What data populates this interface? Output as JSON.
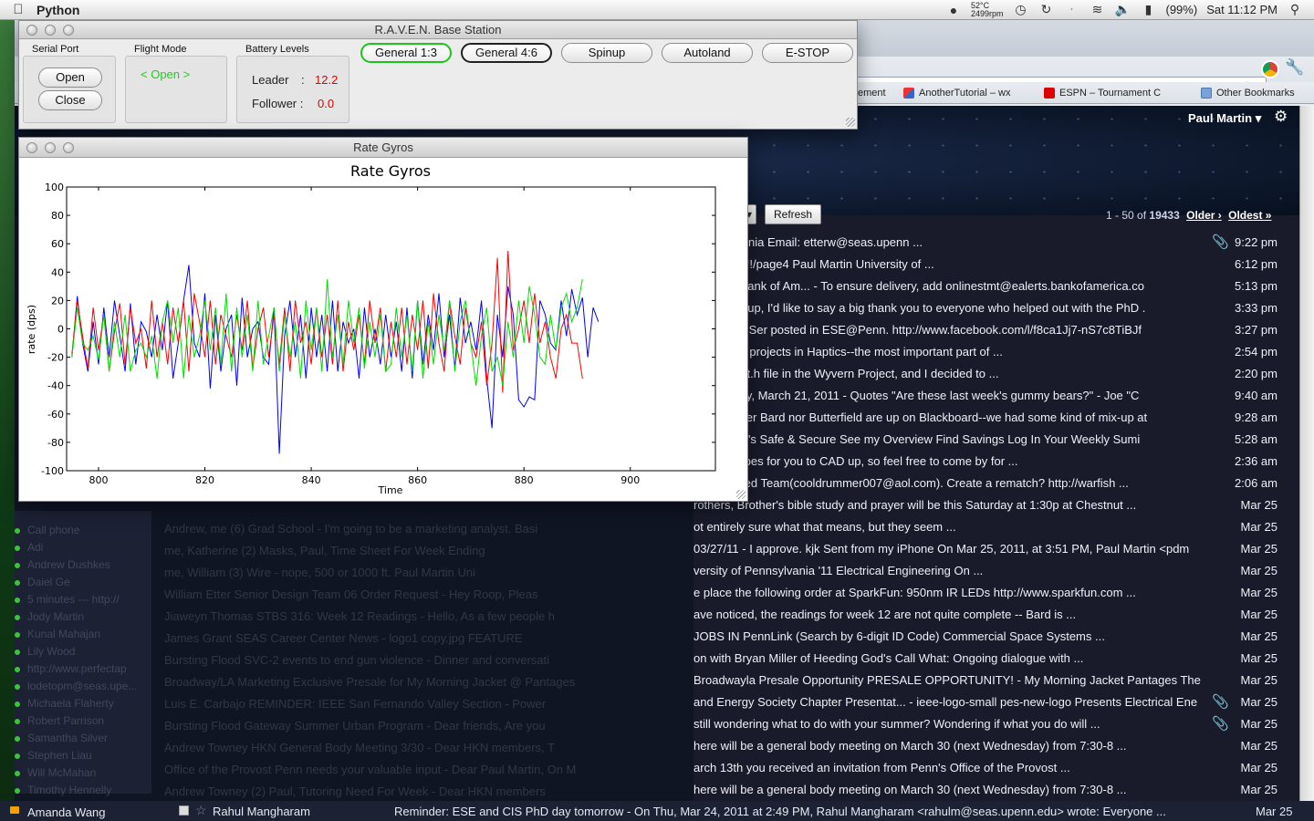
{
  "menubar": {
    "app_name": "Python",
    "temp": "52°C",
    "rpm": "2499rpm",
    "battery": "(99%)",
    "clock": "Sat 11:12 PM"
  },
  "browser": {
    "bookmarks": [
      "ement",
      "AnotherTutorial – wx",
      "ESPN – Tournament C",
      "Other Bookmarks"
    ],
    "user": "Paul Martin",
    "more_label": "s",
    "refresh_label": "Refresh",
    "pager": {
      "range": "1 - 50",
      "of": "of",
      "total": "19433",
      "older": "Older ›",
      "oldest": "Oldest »"
    }
  },
  "emails": [
    {
      "snippet": "Pennsylvania Email: etterw@seas.upenn ...",
      "time": "9:22 pm",
      "attach": true
    },
    {
      "snippet": "New-IMU!!!/page4 Paul Martin University of ...",
      "time": "6:12 pm",
      "attach": false
    },
    {
      "snippet": "ble from Bank of Am... - To ensure delivery, add onlinestmt@ealerts.bankofamerica.co",
      "time": "5:13 pm",
      "attach": false
    },
    {
      "snippet": "aptics Group, I'd like to say a big thank you to everyone who helped out with the PhD .",
      "time": "3:33 pm",
      "attach": false
    },
    {
      "snippet": "Pls... - Jin Ser posted in ESE@Penn. http://www.facebook.com/l/f8ca1Jj7-nS7c8TiBJf",
      "time": "3:27 pm",
      "attach": false
    },
    {
      "snippet": "e for most projects in Haptics--the most important part of ...",
      "time": "2:54 pm",
      "attach": false
    },
    {
      "snippet": "up the uart.h file in the Wyvern Project, and I decided to ...",
      "time": "2:20 pm",
      "attach": false
    },
    {
      "snippet": "on Monday, March 21, 2011 - Quotes \"Are these last week's gummy bears?\" - Joe \"C",
      "time": "9:40 am",
      "attach": false
    },
    {
      "snippet": "ass: Neither Bard nor Butterfield are up on Blackboard--we had some kind of mix-up at",
      "time": "9:28 am",
      "attach": false
    },
    {
      "snippet": "t.com Mint's Safe & Secure See my Overview Find Savings Log In Your Weekly Sumi",
      "time": "5:28 am",
      "attach": false
    },
    {
      "snippet": "crazy shapes for you to CAD up, so feel free to come by for ...",
      "time": "2:36 am",
      "attach": false
    },
    {
      "snippet": "ated by Red Team(cooldrummer007@aol.com). Create a rematch? http://warfish ...",
      "time": "2:06 am",
      "attach": false
    },
    {
      "snippet": "rothers, Brother's bible study and prayer will be this Saturday at 1:30p at Chestnut ...",
      "time": "Mar 25",
      "attach": false
    },
    {
      "snippet": "ot entirely sure what that means, but they seem ...",
      "time": "Mar 25",
      "attach": false
    },
    {
      "snippet": "03/27/11 - I approve. kjk Sent from my iPhone On Mar 25, 2011, at 3:51 PM, Paul Martin <pdm",
      "time": "Mar 25",
      "attach": false
    },
    {
      "snippet": "versity of Pennsylvania '11 Electrical Engineering On ...",
      "time": "Mar 25",
      "attach": false
    },
    {
      "snippet": "e place the following order at SparkFun: 950nm IR LEDs http://www.sparkfun.com ...",
      "time": "Mar 25",
      "attach": false
    },
    {
      "snippet": "ave noticed, the readings for week 12 are not quite complete -- Bard is ...",
      "time": "Mar 25",
      "attach": false
    },
    {
      "snippet": "JOBS IN PennLink (Search by 6-digit ID Code) Commercial Space Systems ...",
      "time": "Mar 25",
      "attach": false
    },
    {
      "snippet": "on with Bryan Miller of Heeding God's Call What: Ongoing dialogue with ...",
      "time": "Mar 25",
      "attach": false
    },
    {
      "snippet": "Broadwayla Presale Opportunity PRESALE OPPORTUNITY! - My Morning Jacket Pantages The",
      "time": "Mar 25",
      "attach": false
    },
    {
      "snippet": "and Energy Society Chapter Presentat... - ieee-logo-small pes-new-logo Presents Electrical Ene",
      "time": "Mar 25",
      "attach": true
    },
    {
      "snippet": "still wondering what to do with your summer? Wondering if what you do will ...",
      "time": "Mar 25",
      "attach": true
    },
    {
      "snippet": "here will be a general body meeting on March 30 (next Wednesday) from 7:30-8 ...",
      "time": "Mar 25",
      "attach": false
    },
    {
      "snippet": "arch 13th you received an invitation from Penn's Office of the Provost ...",
      "time": "Mar 25",
      "attach": false
    },
    {
      "snippet": "here will be a general body meeting on March 30 (next Wednesday) from 7:30-8 ...",
      "time": "Mar 25",
      "attach": false
    }
  ],
  "faded_rows": [
    "Andrew, me (6)   Grad School - I'm going to be a marketing analyst. Basi",
    "me, Katherine (2)   Masks, Paul, Time Sheet For Week Ending",
    "me, William (3)   Wire - nope, 500 or 1000 ft. Paul Martin Uni",
    "William Etter   Senior Design Team 06 Order Request - Hey Roop, Pleas",
    "Jiaweyn Thomas   STBS 316: Week 12 Readings - Hello, As a few people h",
    "James Grant   SEAS Career Center News - logo1 copy.jpg FEATURE",
    "Bursting Flood   SVC-2 events to end gun violence - Dinner and conversati",
    "Broadway/LA Marketing   Exclusive Presale for My Morning Jacket @ Pantages",
    "Luis E. Carbajo   REMINDER: IEEE San Fernando Valley Section - Power",
    "Bursting Flood   Gateway Summer Urban Program - Dear friends, Are you",
    "Andrew Towney   HKN General Body Meeting 3/30 - Dear HKN members, T",
    "Office of the Provost   Penn needs your valuable input - Dear Paul Martin, On M",
    "Andrew Towney (2)   Paul, Tutoring Need For Week - Dear HKN members"
  ],
  "contacts": [
    "Call phone",
    "Adi",
    "Andrew Dushkes",
    "Daiel Ge",
    "5 minutes --- http://",
    "Jody Martin",
    "Kunal Mahajan",
    "Lily Wood",
    "http://www.perfectap",
    "lodetopm@seas.upe...",
    "Michaela Flaherty",
    "Robert Parrison",
    "Samantha Silver",
    "Stephen Liau",
    "Will McMahan",
    "Timothy Hennelly"
  ],
  "bottom_row": {
    "contact": "Amanda Wang",
    "sender": "Rahul Mangharam",
    "snippet": "Reminder: ESE and CIS PhD day tomorrow - On Thu, Mar 24, 2011 at 2:49 PM, Rahul Mangharam <rahulm@seas.upenn.edu> wrote: Everyone ...",
    "time": "Mar 25"
  },
  "raven": {
    "title": "R.A.V.E.N. Base Station",
    "serial_port_label": "Serial Port",
    "open_btn": "Open",
    "close_btn": "Close",
    "flight_mode_label": "Flight Mode",
    "flight_mode_value": "< Open >",
    "battery_label": "Battery Levels",
    "leader_label": "Leader",
    "leader_value": "12.2",
    "follower_label": "Follower :",
    "follower_value": "0.0",
    "colon": ":",
    "buttons": [
      "General 1:3",
      "General 4:6",
      "Spinup",
      "Autoland",
      "E-STOP"
    ],
    "colors": {
      "flight_mode": "#22cc22",
      "battery_value": "#e00000",
      "selected_green": "#1cc41c"
    }
  },
  "gyros_window": {
    "title": "Rate Gyros"
  },
  "chart_data": {
    "type": "line",
    "title": "Rate Gyros",
    "xlabel": "Time",
    "ylabel": "rate (dps)",
    "xlim": [
      794,
      916
    ],
    "ylim": [
      -100,
      100
    ],
    "xticks": [
      800,
      820,
      840,
      860,
      880,
      900
    ],
    "yticks": [
      100,
      80,
      60,
      40,
      20,
      0,
      -20,
      -40,
      -60,
      -80,
      -100
    ],
    "grid": false,
    "x_start": 795,
    "x_step": 1,
    "series": [
      {
        "color": "#0000ff",
        "values": [
          -20,
          23,
          -10,
          -30,
          5,
          -25,
          15,
          -20,
          20,
          -5,
          -30,
          18,
          -25,
          5,
          -2,
          -20,
          10,
          -15,
          20,
          -35,
          -10,
          20,
          45,
          -10,
          -20,
          25,
          -42,
          10,
          -30,
          0,
          10,
          -40,
          22,
          -20,
          0,
          5,
          -20,
          -25,
          15,
          -88,
          -5,
          20,
          -20,
          10,
          -35,
          15,
          -20,
          10,
          -30,
          20,
          -30,
          5,
          -10,
          0,
          -35,
          15,
          -20,
          0,
          -25,
          10,
          -20,
          5,
          -30,
          15,
          -35,
          20,
          -25,
          10,
          -15,
          25,
          -20,
          10,
          -28,
          22,
          -10,
          5,
          -15,
          20,
          -35,
          -70,
          10,
          -20,
          30,
          10,
          -50,
          -55,
          -48,
          -50,
          20,
          10,
          -10,
          -15,
          20,
          -5,
          28,
          10,
          22,
          -20,
          15,
          5
        ]
      },
      {
        "color": "#ff0000",
        "values": [
          -18,
          20,
          -5,
          -28,
          15,
          -15,
          10,
          -30,
          -2,
          18,
          -25,
          15,
          -10,
          0,
          -28,
          20,
          -20,
          5,
          -25,
          15,
          -10,
          20,
          -30,
          25,
          5,
          -20,
          20,
          -25,
          10,
          -5,
          -20,
          10,
          -15,
          20,
          -28,
          0,
          15,
          -20,
          10,
          -25,
          15,
          -30,
          20,
          -10,
          5,
          -25,
          15,
          -20,
          10,
          -25,
          20,
          -30,
          5,
          -15,
          10,
          -25,
          20,
          -10,
          15,
          -30,
          5,
          -20,
          15,
          -25,
          10,
          -15,
          20,
          -28,
          25,
          -10,
          -30,
          20,
          -5,
          -25,
          15,
          -10,
          -20,
          5,
          -40,
          -10,
          50,
          -45,
          55,
          -15,
          0,
          20,
          -10,
          25,
          -10,
          5,
          -20,
          -35,
          0,
          10,
          -10,
          -10,
          -35
        ]
      },
      {
        "color": "#00dd00",
        "values": [
          -20,
          15,
          -10,
          -15,
          -5,
          -22,
          10,
          -30,
          5,
          -20,
          10,
          -30,
          -15,
          -10,
          -20,
          -5,
          -35,
          5,
          20,
          -10,
          15,
          -35,
          10,
          -20,
          -5,
          20,
          -15,
          15,
          -25,
          25,
          -30,
          15,
          -20,
          10,
          -30,
          20,
          -25,
          -5,
          15,
          -30,
          10,
          -20,
          5,
          -35,
          20,
          -15,
          15,
          -30,
          35,
          -20,
          10,
          -25,
          20,
          -10,
          15,
          -28,
          5,
          -20,
          10,
          -30,
          -25,
          15,
          -20,
          10,
          -30,
          20,
          -35,
          5,
          -25,
          10,
          -15,
          20,
          -30,
          5,
          20,
          -10,
          -40,
          -5,
          15,
          -30,
          -20,
          -40,
          5,
          -20,
          20,
          -10,
          30,
          10,
          -20,
          -25,
          10,
          -15,
          15,
          25,
          5,
          15,
          35
        ]
      }
    ]
  }
}
